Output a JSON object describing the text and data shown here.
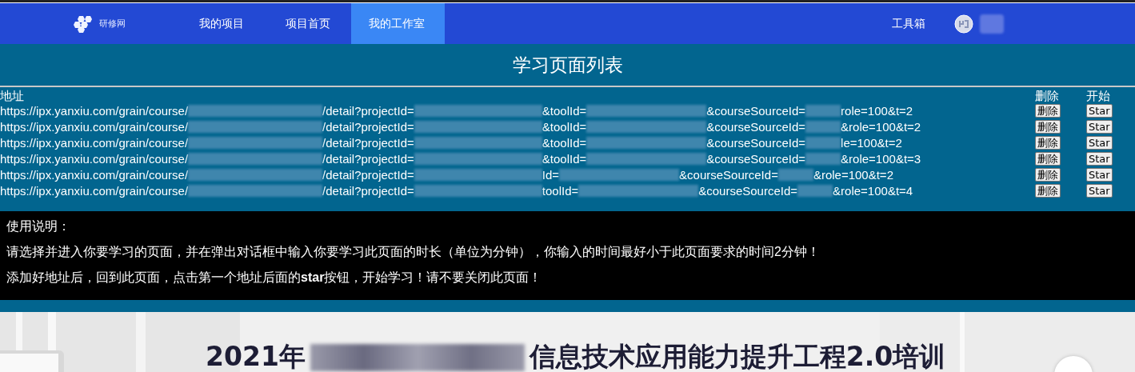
{
  "nav": {
    "logo_text": "研修网",
    "items": [
      {
        "label": "我的项目",
        "selected": false
      },
      {
        "label": "项目首页",
        "selected": false
      },
      {
        "label": "我的工作室",
        "selected": true
      }
    ],
    "toolbox": "工具箱"
  },
  "title": "学习页面列表",
  "table": {
    "columns": [
      "地址",
      "删除",
      "开始"
    ],
    "rows": [
      {
        "segments": [
          {
            "kind": "text",
            "text": "https://ipx.yanxiu.com/grain/course/"
          },
          {
            "kind": "blur"
          },
          {
            "kind": "text",
            "text": "/detail?projectId="
          },
          {
            "kind": "blur"
          },
          {
            "kind": "text",
            "text": "&toolId="
          },
          {
            "kind": "blur"
          },
          {
            "kind": "text",
            "text": "&courseSourceId="
          },
          {
            "kind": "blur"
          },
          {
            "kind": "text",
            "text": "role=100&t=2"
          }
        ],
        "delete": "删除",
        "start": "Star"
      },
      {
        "segments": [
          {
            "kind": "text",
            "text": "https://ipx.yanxiu.com/grain/course/"
          },
          {
            "kind": "blur"
          },
          {
            "kind": "text",
            "text": "/detail?projectId="
          },
          {
            "kind": "blur"
          },
          {
            "kind": "text",
            "text": "&toolId="
          },
          {
            "kind": "blur"
          },
          {
            "kind": "text",
            "text": "&courseSourceId="
          },
          {
            "kind": "blur"
          },
          {
            "kind": "text",
            "text": "&role=100&t=2"
          }
        ],
        "delete": "删除",
        "start": "Star"
      },
      {
        "segments": [
          {
            "kind": "text",
            "text": "https://ipx.yanxiu.com/grain/course/"
          },
          {
            "kind": "blur"
          },
          {
            "kind": "text",
            "text": "/detail?projectId="
          },
          {
            "kind": "blur"
          },
          {
            "kind": "text",
            "text": "&toolId="
          },
          {
            "kind": "blur"
          },
          {
            "kind": "text",
            "text": "&courseSourceId="
          },
          {
            "kind": "blur"
          },
          {
            "kind": "text",
            "text": "le=100&t=2"
          }
        ],
        "delete": "删除",
        "start": "Star"
      },
      {
        "segments": [
          {
            "kind": "text",
            "text": "https://ipx.yanxiu.com/grain/course/"
          },
          {
            "kind": "blur"
          },
          {
            "kind": "text",
            "text": "/detail?projectId="
          },
          {
            "kind": "blur"
          },
          {
            "kind": "text",
            "text": "&toolId="
          },
          {
            "kind": "blur"
          },
          {
            "kind": "text",
            "text": "&courseSourceId="
          },
          {
            "kind": "blur"
          },
          {
            "kind": "text",
            "text": "&role=100&t=3"
          }
        ],
        "delete": "删除",
        "start": "Star"
      },
      {
        "segments": [
          {
            "kind": "text",
            "text": "https://ipx.yanxiu.com/grain/course/"
          },
          {
            "kind": "blur"
          },
          {
            "kind": "text",
            "text": "/detail?projectId="
          },
          {
            "kind": "blur"
          },
          {
            "kind": "text",
            "text": "Id="
          },
          {
            "kind": "blur"
          },
          {
            "kind": "text",
            "text": "&courseSourceId="
          },
          {
            "kind": "blur"
          },
          {
            "kind": "text",
            "text": "&role=100&t=2"
          }
        ],
        "delete": "删除",
        "start": "Star"
      },
      {
        "segments": [
          {
            "kind": "text",
            "text": "https://ipx.yanxiu.com/grain/course/"
          },
          {
            "kind": "blur"
          },
          {
            "kind": "text",
            "text": "/detail?projectId="
          },
          {
            "kind": "blur"
          },
          {
            "kind": "text",
            "text": "toolId="
          },
          {
            "kind": "blur"
          },
          {
            "kind": "text",
            "text": "&courseSourceId="
          },
          {
            "kind": "blur"
          },
          {
            "kind": "text",
            "text": "&role=100&t=4"
          }
        ],
        "delete": "删除",
        "start": "Star"
      }
    ]
  },
  "instructions": [
    "使用说明：",
    "请选择并进入你要学习的页面，并在弹出对话框中输入你要学习此页面的时长（单位为分钟），你输入的时间最好小于此页面要求的时间2分钟！",
    "添加好地址后，回到此页面，点击第一个地址后面的**star**按钮，开始学习！请不要关闭此页面！"
  ],
  "banner": {
    "title_start": "2021年",
    "title_end": "信息技术应用能力提升工程2.0培训"
  }
}
